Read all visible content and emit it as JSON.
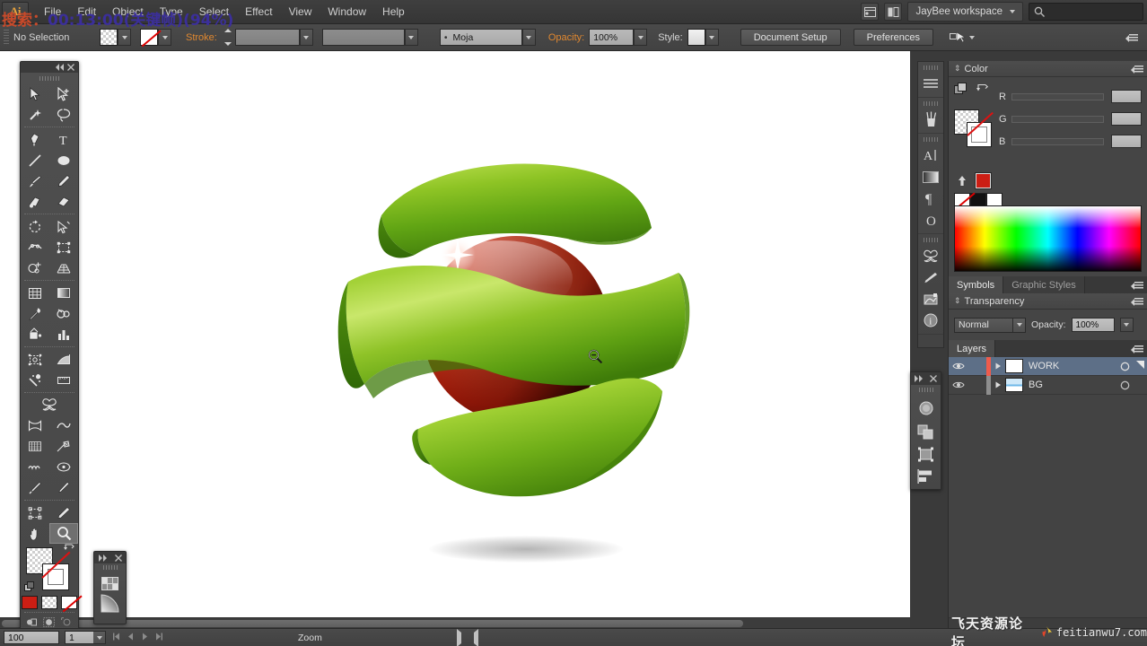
{
  "app": {
    "logo": "Ai",
    "workspace": "JayBee workspace",
    "search_icon": "search-icon"
  },
  "menubar": {
    "items": [
      "File",
      "Edit",
      "Object",
      "Type",
      "Select",
      "Effect",
      "View",
      "Window",
      "Help"
    ]
  },
  "overlay": {
    "prefix": "搜索：",
    "value": "00:13:00(关键帧)(94%)"
  },
  "controlbar": {
    "selection_status": "No Selection",
    "stroke_label": "Stroke:",
    "stroke_weight": "",
    "stroke_profile": "",
    "brush_definition": "Moja",
    "opacity_label": "Opacity:",
    "opacity_value": "100%",
    "style_label": "Style:",
    "document_setup": "Document Setup",
    "preferences": "Preferences"
  },
  "toolbar": {
    "tools": [
      {
        "name": "selection-tool",
        "label": "Selection"
      },
      {
        "name": "direct-selection-tool",
        "label": "Direct Selection"
      },
      {
        "name": "magic-wand-tool",
        "label": "Magic Wand"
      },
      {
        "name": "lasso-tool",
        "label": "Lasso"
      },
      {
        "name": "pen-tool",
        "label": "Pen"
      },
      {
        "name": "type-tool",
        "label": "Type"
      },
      {
        "name": "line-segment-tool",
        "label": "Line Segment"
      },
      {
        "name": "ellipse-tool",
        "label": "Ellipse"
      },
      {
        "name": "paintbrush-tool",
        "label": "Paintbrush"
      },
      {
        "name": "pencil-tool",
        "label": "Pencil"
      },
      {
        "name": "blob-brush-tool",
        "label": "Blob Brush"
      },
      {
        "name": "eraser-tool",
        "label": "Eraser"
      },
      {
        "name": "rotate-tool",
        "label": "Rotate"
      },
      {
        "name": "scale-tool",
        "label": "Scale"
      },
      {
        "name": "width-tool",
        "label": "Width"
      },
      {
        "name": "free-transform-tool",
        "label": "Free Transform"
      },
      {
        "name": "shape-builder-tool",
        "label": "Shape Builder"
      },
      {
        "name": "perspective-grid-tool",
        "label": "Perspective Grid"
      },
      {
        "name": "mesh-tool",
        "label": "Mesh"
      },
      {
        "name": "gradient-tool",
        "label": "Gradient"
      },
      {
        "name": "eyedropper-tool",
        "label": "Eyedropper"
      },
      {
        "name": "blend-tool",
        "label": "Blend"
      },
      {
        "name": "live-paint-bucket-tool",
        "label": "Live Paint Bucket"
      },
      {
        "name": "column-graph-tool",
        "label": "Column Graph"
      },
      {
        "name": "artboard-tool",
        "label": "Artboard"
      },
      {
        "name": "slice-tool",
        "label": "Slice"
      },
      {
        "name": "symbol-sprayer-tool",
        "label": "Symbol Sprayer"
      },
      {
        "name": "measure-tool",
        "label": "Measure"
      },
      {
        "name": "warp-tool",
        "label": "Warp"
      },
      {
        "name": "free-distort-tool",
        "label": "Free Distort"
      },
      {
        "name": "wrinkle-tool",
        "label": "Wrinkle"
      },
      {
        "name": "crystallize-tool",
        "label": "Crystallize"
      },
      {
        "name": "scallop-tool",
        "label": "Scallop"
      },
      {
        "name": "bloat-tool",
        "label": "Bloat"
      },
      {
        "name": "knife-tool",
        "label": "Knife"
      },
      {
        "name": "scissors-tool",
        "label": "Scissors"
      },
      {
        "name": "crop-tool",
        "label": "Crop"
      },
      {
        "name": "smooth-tool",
        "label": "Smooth"
      },
      {
        "name": "hand-tool",
        "label": "Hand"
      },
      {
        "name": "zoom-tool",
        "label": "Zoom",
        "active": true
      }
    ],
    "fill_color": "#ffffff",
    "stroke_color": "none",
    "mini_swatches": [
      "#cc1e14",
      "#ffffff",
      "none"
    ]
  },
  "icon_dock": {
    "icons": [
      "stroke-icon",
      "brushes-icon",
      "type-icon",
      "gradient-icon",
      "paragraph-icon",
      "character-icon",
      "symbols-icon",
      "appearance-icon",
      "links-icon",
      "info-icon"
    ]
  },
  "float_panel_right": {
    "collapse_icon": "collapse-right-icon",
    "close_icon": "close-icon",
    "icons": [
      "3d-effects-icon",
      "pathfinder-icon",
      "transform-icon",
      "align-icon"
    ]
  },
  "mini_panel_left": {
    "collapse_icon": "collapse-right-icon",
    "close_icon": "close-icon",
    "icons": [
      "swatches-icon",
      "gradient-panel-icon"
    ]
  },
  "color_panel": {
    "title": "Color",
    "sliders": [
      {
        "label": "R",
        "value": ""
      },
      {
        "label": "G",
        "value": ""
      },
      {
        "label": "B",
        "value": ""
      }
    ],
    "hex_label": "#",
    "hex_value": "",
    "current_color": "#cc1e14",
    "spectrum": "rgb-spectrum-ramp"
  },
  "symbols_tabs": {
    "tabs": [
      "Symbols",
      "Graphic Styles"
    ],
    "active": 0
  },
  "transparency_panel": {
    "title": "Transparency",
    "blend_mode": "Normal",
    "opacity_label": "Opacity:",
    "opacity_value": "100%"
  },
  "layers_panel": {
    "title": "Layers",
    "layers": [
      {
        "name": "WORK",
        "visible": true,
        "selected": true,
        "color": "#ef5b4c"
      },
      {
        "name": "BG",
        "visible": true,
        "selected": false,
        "color": "#8e8e8e"
      }
    ]
  },
  "statusbar": {
    "zoom_level": "100",
    "artboard_number": "1",
    "tool_name": "Zoom"
  },
  "watermark": {
    "cn": "飞天资源论坛",
    "en": "feitianwu7.com"
  },
  "artwork": {
    "description": "red glossy sphere wrapped by three green ribbon bands",
    "sphere_color": "#d22a14",
    "ribbon_color_light": "#a6d13a",
    "ribbon_color_dark": "#4e8c12",
    "cursor": "zoom-out-cursor"
  }
}
